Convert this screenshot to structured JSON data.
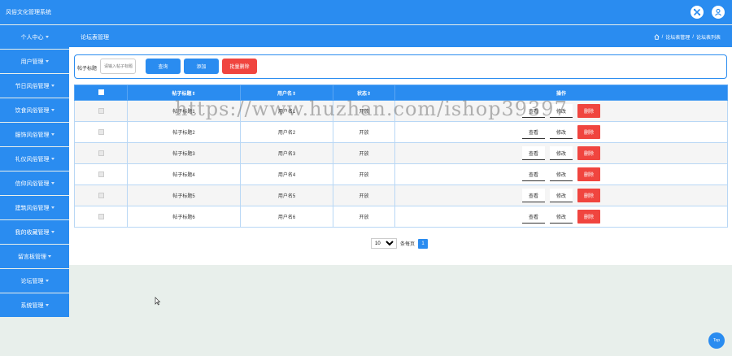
{
  "app": {
    "title": "风俗文化管理系统"
  },
  "header": {
    "page_title": "论坛表管理"
  },
  "breadcrumb": {
    "items": [
      "论坛表管理",
      "论坛表列表"
    ],
    "sep": "/"
  },
  "sidebar": {
    "items": [
      {
        "label": "个人中心"
      },
      {
        "label": "用户管理"
      },
      {
        "label": "节日风俗管理"
      },
      {
        "label": "饮食风俗管理"
      },
      {
        "label": "服饰风俗管理"
      },
      {
        "label": "礼仪风俗管理"
      },
      {
        "label": "信仰风俗管理"
      },
      {
        "label": "建筑风俗管理"
      },
      {
        "label": "我的收藏管理"
      },
      {
        "label": "留言板管理"
      },
      {
        "label": "论坛管理"
      },
      {
        "label": "系统管理"
      }
    ]
  },
  "search": {
    "label": "帖子标题",
    "placeholder": "请输入帖子标题",
    "query_button": "查询",
    "add_button": "添加",
    "batch_delete_button": "批量删除"
  },
  "table": {
    "columns": [
      "帖子标题⇕",
      "用户名⇕",
      "状态⇕",
      "操作"
    ],
    "rows": [
      {
        "title": "帖子标题1",
        "username": "用户名1",
        "status": "开放"
      },
      {
        "title": "帖子标题2",
        "username": "用户名2",
        "status": "开放"
      },
      {
        "title": "帖子标题3",
        "username": "用户名3",
        "status": "开放"
      },
      {
        "title": "帖子标题4",
        "username": "用户名4",
        "status": "开放"
      },
      {
        "title": "帖子标题5",
        "username": "用户名5",
        "status": "开放"
      },
      {
        "title": "帖子标题6",
        "username": "用户名6",
        "status": "开放"
      }
    ],
    "actions": {
      "view": "查看",
      "edit": "修改",
      "delete": "删除"
    }
  },
  "pagination": {
    "page_size": "10",
    "per_page_label": "条每页",
    "current_page": "1"
  },
  "watermark": "https://www.huzhan.com/ishop39397",
  "top_button": "Top",
  "colors": {
    "primary": "#2a8cf0",
    "danger": "#f0453f",
    "background": "#e8efeb"
  },
  "icons": {
    "tools": "tools-icon",
    "user": "user-icon",
    "home": "home-icon"
  }
}
